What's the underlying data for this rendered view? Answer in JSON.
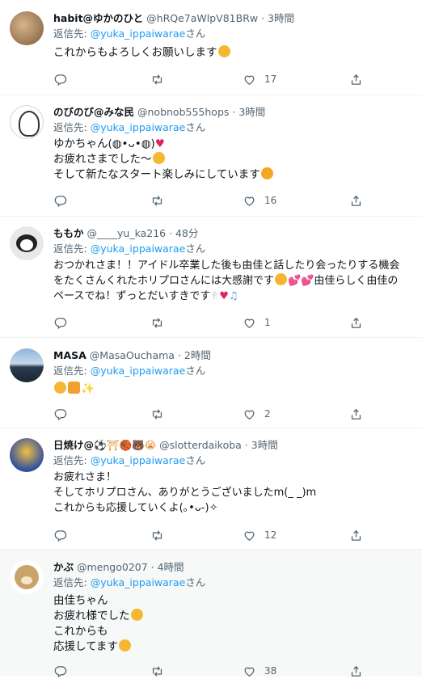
{
  "common": {
    "reply_prefix": "返信先: ",
    "reply_suffix": "さん"
  },
  "tweets": [
    {
      "name": "habit@ゆかのひと",
      "handle": "@hRQe7aWlpV81BRw",
      "time": "3時間",
      "reply_to": "@yuka_ippaiwarae",
      "lines": [
        "これからもよろしくお願いします"
      ],
      "likes": "17"
    },
    {
      "name": "のびのび@みな民",
      "handle": "@nobnob555hops",
      "time": "3時間",
      "reply_to": "@yuka_ippaiwarae",
      "lines": [
        "ゆかちゃん(◍•ᴗ•◍)",
        "お疲れさまでした〜",
        "そして新たなスタート楽しみにしています"
      ],
      "likes": "16"
    },
    {
      "name": "ももか",
      "handle": "@____yu_ka216",
      "time": "48分",
      "reply_to": "@yuka_ippaiwarae",
      "lines": [
        "おつかれさま！！アイドル卒業した後も由佳と話したり会ったりする機会",
        "をたくさんくれたホリプロさんには大感謝です",
        "ペースでね！ずっとだいすきです"
      ],
      "line2_tail": "由佳らしく由佳の",
      "likes": "1"
    },
    {
      "name": "MASA",
      "handle": "@MasaOuchama",
      "time": "2時間",
      "reply_to": "@yuka_ippaiwarae",
      "lines": [
        ""
      ],
      "likes": "2"
    },
    {
      "name": "日焼け@",
      "handle": "@slotterdaikoba",
      "time": "3時間",
      "reply_to": "@yuka_ippaiwarae",
      "lines": [
        "お疲れさま！",
        "そしてホリプロさん、ありがとうございましたm(_ _)m",
        "これからも応援していくよ(｡•ᴗ-)✧"
      ],
      "likes": "12"
    },
    {
      "name": "かぶ",
      "handle": "@mengo0207",
      "time": "4時間",
      "reply_to": "@yuka_ippaiwarae",
      "lines": [
        "由佳ちゃん",
        "お疲れ様でした",
        "これからも",
        "応援してます"
      ],
      "likes": "38"
    }
  ],
  "icons": [
    "reply-icon",
    "retweet-icon",
    "like-icon",
    "share-icon"
  ],
  "colors": {
    "link": "#1d9bf0",
    "muted": "#536471",
    "text": "#0f1419",
    "highlight_bg": "#f7f9f9"
  }
}
